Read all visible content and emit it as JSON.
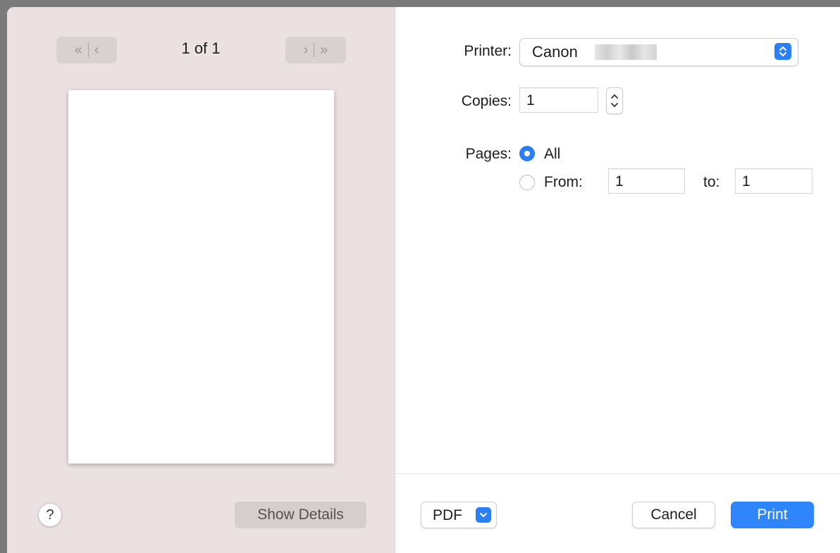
{
  "preview": {
    "page_indicator": "1 of 1",
    "nav": {
      "first_icon": "first-page-icon",
      "prev_icon": "previous-page-icon",
      "next_icon": "next-page-icon",
      "last_icon": "last-page-icon"
    },
    "help_label": "?",
    "show_details_label": "Show Details"
  },
  "form": {
    "printer_label": "Printer:",
    "printer_value": "Canon",
    "copies_label": "Copies:",
    "copies_value": "1",
    "pages_label": "Pages:",
    "pages_all_label": "All",
    "pages_from_label": "From:",
    "pages_from_value": "1",
    "pages_to_label": "to:",
    "pages_to_value": "1",
    "pages_selected": "All"
  },
  "footer": {
    "pdf_label": "PDF",
    "cancel_label": "Cancel",
    "print_label": "Print"
  },
  "colors": {
    "accent": "#2f86fa",
    "sidebar_bg": "#ebe1e2"
  }
}
